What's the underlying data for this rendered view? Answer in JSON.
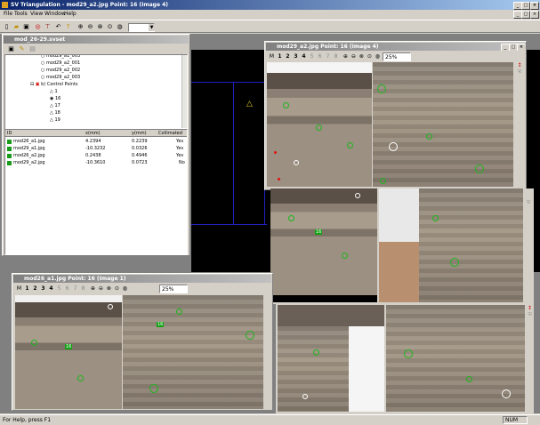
{
  "app": {
    "title": "SV Triangulation - mod29_a2.jpg Point: 16 (Image 4)"
  },
  "menu": [
    "File",
    "Tools",
    "View",
    "Window",
    "Help"
  ],
  "toolbar": {
    "zoom_select": ""
  },
  "left_window": {
    "title": "mod_26-29.svset",
    "tree": [
      {
        "label": "mod29_a1_003",
        "icon": "circle-icon"
      },
      {
        "label": "mod29_a2_001",
        "icon": "circle-icon"
      },
      {
        "label": "mod29_a2_002",
        "icon": "circle-icon"
      },
      {
        "label": "mod29_a2_003",
        "icon": "circle-icon"
      },
      {
        "label": "b) Control Points",
        "icon": "folder-icon"
      },
      {
        "label": "1",
        "icon": "triangle-icon"
      },
      {
        "label": "16",
        "icon": "eye-icon"
      },
      {
        "label": "17",
        "icon": "triangle-icon"
      },
      {
        "label": "18",
        "icon": "triangle-icon"
      },
      {
        "label": "19",
        "icon": "triangle-icon"
      }
    ],
    "table": {
      "headers": [
        "ID",
        "x(mm)",
        "y(mm)",
        "Collimated"
      ],
      "rows": [
        [
          "mod26_a1.jpg",
          "4.2394",
          "0.2239",
          "Yes"
        ],
        [
          "mod29_a1.jpg",
          "-10.3232",
          "0.0326",
          "Yes"
        ],
        [
          "mod26_a2.jpg",
          "0.2438",
          "0.4946",
          "Yes"
        ],
        [
          "mod29_a2.jpg",
          "-10.3610",
          "0.0723",
          "No"
        ]
      ]
    }
  },
  "image4_window": {
    "title": "mod29_a2.jpg Point: 16 (Image 4)",
    "toolbar": [
      "M",
      "1",
      "2",
      "3",
      "4",
      "5",
      "6",
      "7",
      "8"
    ],
    "zoom": "25%"
  },
  "image1_window": {
    "title": "mod26_a1.jpg Point: 16 (Image 1)",
    "toolbar": [
      "M",
      "1",
      "2",
      "3",
      "4",
      "5",
      "6",
      "7",
      "8"
    ],
    "zoom": "25%"
  },
  "point_labels": {
    "a": "16",
    "b": "16",
    "c": "16"
  },
  "status": {
    "left": "For Help, press F1",
    "right": "NUM"
  },
  "colors": {
    "title_active": "#0a246a",
    "point_green": "#1db51d",
    "point_red": "#e01010"
  }
}
